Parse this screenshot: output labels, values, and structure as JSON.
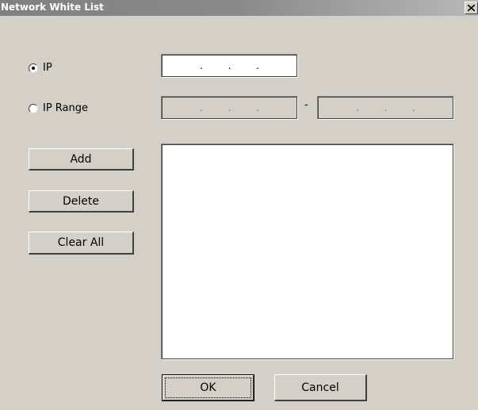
{
  "window": {
    "title": "Network White List",
    "close_glyph": "×"
  },
  "options": {
    "ip_label": "IP",
    "ip_range_label": "IP Range",
    "selected": "IP"
  },
  "ip_field": {
    "segments": [
      "",
      "",
      "",
      ""
    ],
    "separator": "."
  },
  "range_start": {
    "segments": [
      "",
      "",
      "",
      ""
    ],
    "separator": "."
  },
  "range_end": {
    "segments": [
      "",
      "",
      "",
      ""
    ],
    "separator": "."
  },
  "range_separator": "-",
  "buttons": {
    "add": "Add",
    "delete": "Delete",
    "clear_all": "Clear All",
    "ok": "OK",
    "cancel": "Cancel"
  },
  "list": {
    "items": []
  },
  "icons": {
    "close": "close-icon"
  },
  "colors": {
    "face": "#d4d0c8",
    "title_bar": "#808080"
  }
}
